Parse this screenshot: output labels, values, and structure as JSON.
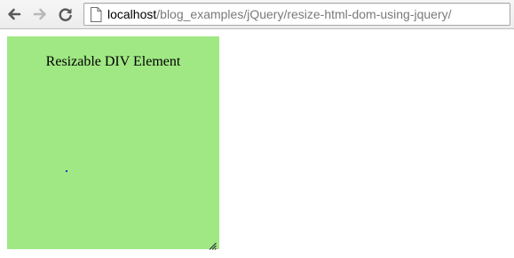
{
  "browser": {
    "url_host": "localhost",
    "url_path": "/blog_examples/jQuery/resize-html-dom-using-jquery/",
    "icons": {
      "back": "arrow-left-icon",
      "forward": "arrow-right-icon",
      "reload": "reload-icon",
      "page": "page-icon"
    }
  },
  "page": {
    "resizable_title": "Resizable DIV Element",
    "colors": {
      "box_background": "#a0e884",
      "dot": "#1a3cc8"
    }
  }
}
